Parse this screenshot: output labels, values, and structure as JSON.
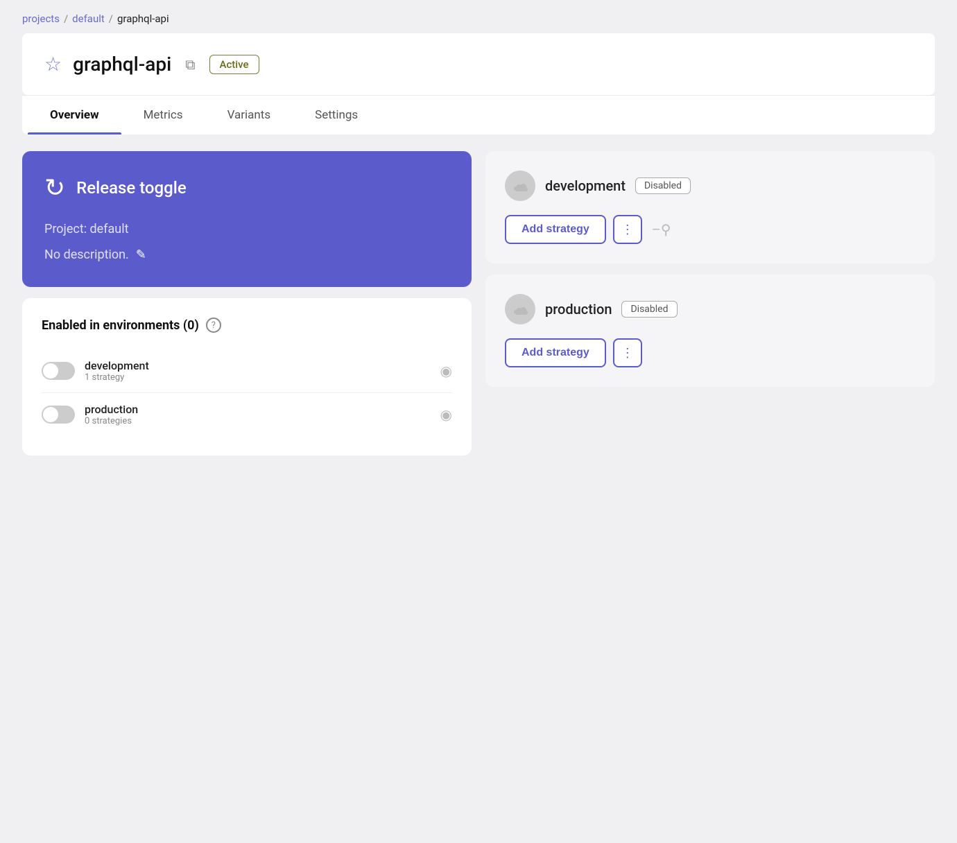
{
  "breadcrumb": {
    "projects_label": "projects",
    "sep1": "/",
    "default_label": "default",
    "sep2": "/",
    "current": "graphql-api"
  },
  "header": {
    "title": "graphql-api",
    "status": "Active"
  },
  "tabs": [
    {
      "label": "Overview",
      "active": true
    },
    {
      "label": "Metrics",
      "active": false
    },
    {
      "label": "Variants",
      "active": false
    },
    {
      "label": "Settings",
      "active": false
    }
  ],
  "toggle_card": {
    "title": "Release toggle",
    "project_label": "Project: default",
    "description": "No description.",
    "refresh_icon": "↻",
    "edit_icon": "✎"
  },
  "environments_card": {
    "title": "Enabled in environments (0)",
    "help_icon": "?",
    "environments": [
      {
        "name": "development",
        "strategy": "1 strategy"
      },
      {
        "name": "production",
        "strategy": "0 strategies"
      }
    ]
  },
  "right_environments": [
    {
      "name": "development",
      "status": "Disabled",
      "add_strategy_label": "Add strategy",
      "more_icon": "⋮",
      "lock_icon": "⚲"
    },
    {
      "name": "production",
      "status": "Disabled",
      "add_strategy_label": "Add strategy",
      "more_icon": "⋮"
    }
  ],
  "icons": {
    "star": "☆",
    "copy": "⧉",
    "cloud": "☁",
    "eye": "◉",
    "lock": "–"
  }
}
